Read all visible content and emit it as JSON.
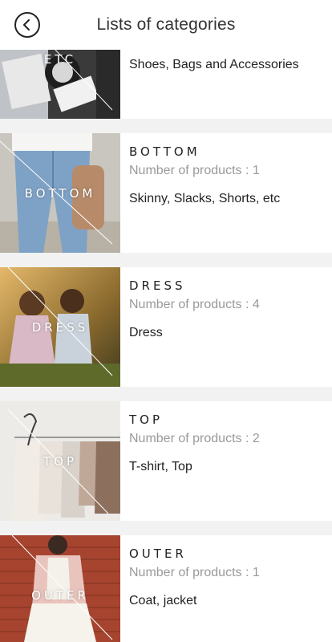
{
  "header": {
    "title": "Lists of categories",
    "back_icon": "back-arrow-circle-icon"
  },
  "categories": [
    {
      "thumb_label": "ETC",
      "name": "",
      "count_text": "",
      "description": "Shoes, Bags and Accessories",
      "palette": [
        "#2b2b2b",
        "#d9d9d9",
        "#a0522d"
      ]
    },
    {
      "thumb_label": "BOTTOM",
      "name": "BOTTOM",
      "count_text": "Number of products : 1",
      "description": "Skinny, Slacks, Shorts, etc",
      "palette": [
        "#6f93b8",
        "#d8d4cc",
        "#8a7b6a"
      ]
    },
    {
      "thumb_label": "DRESS",
      "name": "DRESS",
      "count_text": "Number of products : 4",
      "description": "Dress",
      "palette": [
        "#c48a3a",
        "#6f6a2e",
        "#e0b7c2"
      ]
    },
    {
      "thumb_label": "TOP",
      "name": "TOP",
      "count_text": "Number of products : 2",
      "description": "T-shirt, Top",
      "palette": [
        "#e9e7e3",
        "#c9bfb3",
        "#9a8f86"
      ]
    },
    {
      "thumb_label": "OUTER",
      "name": "OUTER",
      "count_text": "Number of products : 1",
      "description": "Coat, jacket",
      "palette": [
        "#a44a35",
        "#e7c5c0",
        "#f3f0ea"
      ]
    }
  ]
}
